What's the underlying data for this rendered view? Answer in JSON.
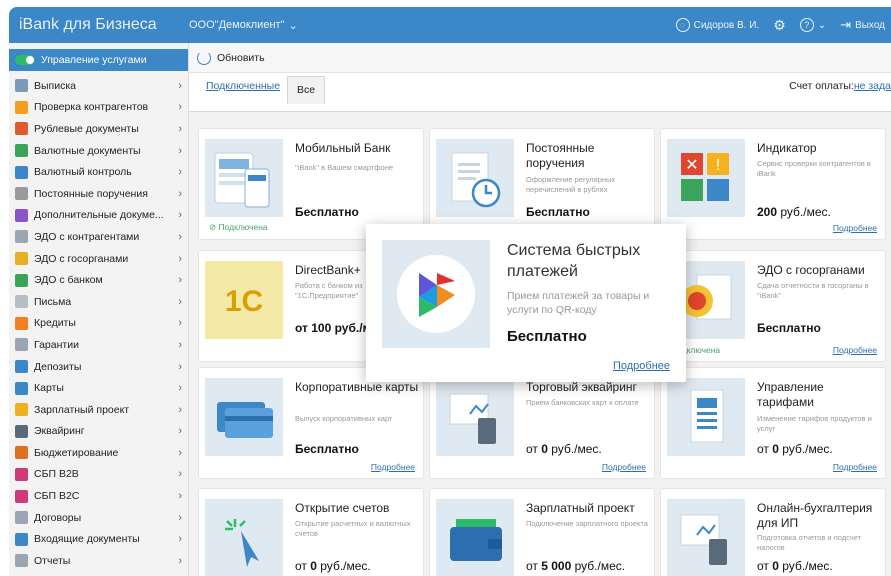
{
  "header": {
    "brand": "iBank для Бизнеса",
    "org": "ООО\"Демоклиент\"",
    "user": "Сидоров В. И.",
    "logout": "Выход"
  },
  "toolbar": {
    "refresh": "Обновить"
  },
  "sidebar": {
    "active": "Управление услугами",
    "items": [
      {
        "label": "Выписка",
        "color": "#7a9bb8"
      },
      {
        "label": "Проверка контрагентов",
        "color": "#f0a020"
      },
      {
        "label": "Рублевые документы",
        "color": "#e05a30"
      },
      {
        "label": "Валютные документы",
        "color": "#3aa55a"
      },
      {
        "label": "Валютный контроль",
        "color": "#3b87c8"
      },
      {
        "label": "Постоянные поручения",
        "color": "#9a9a9a"
      },
      {
        "label": "Дополнительные докуме...",
        "color": "#8a55c8"
      },
      {
        "label": "ЭДО с контрагентами",
        "color": "#9aa7b3"
      },
      {
        "label": "ЭДО с госорганами",
        "color": "#e8b020"
      },
      {
        "label": "ЭДО с банком",
        "color": "#3aa55a"
      },
      {
        "label": "Письма",
        "color": "#b5bec7"
      },
      {
        "label": "Кредиты",
        "color": "#f08020"
      },
      {
        "label": "Гарантии",
        "color": "#9aa7b3"
      },
      {
        "label": "Депозиты",
        "color": "#3b87c8"
      },
      {
        "label": "Карты",
        "color": "#3b87c8"
      },
      {
        "label": "Зарплатный проект",
        "color": "#f0b020"
      },
      {
        "label": "Эквайринг",
        "color": "#5a6a7a"
      },
      {
        "label": "Бюджетирование",
        "color": "#e07020"
      },
      {
        "label": "СБП B2B",
        "color": "#d03a7a"
      },
      {
        "label": "СБП B2C",
        "color": "#d03a7a"
      },
      {
        "label": "Договоры",
        "color": "#9aa7b3"
      },
      {
        "label": "Входящие документы",
        "color": "#3b87c8"
      },
      {
        "label": "Отчеты",
        "color": "#9aa7b3"
      }
    ]
  },
  "tabs": {
    "connected": "Подключенные",
    "all": "Все"
  },
  "account": {
    "label": "Счет оплаты:",
    "value": "не зада"
  },
  "popup": {
    "title": "Система быстрых платежей",
    "desc": "Прием платежей за товары и услуги по QR-коду",
    "price": "Бесплатно",
    "more": "Подробнее"
  },
  "cards": {
    "mobile": {
      "title": "Мобильный Банк",
      "desc": "\"iBank\" в Вашем смартфоне",
      "price_bold": "Бесплатно",
      "price_rest": "",
      "status": "Подключена"
    },
    "orders": {
      "title": "Постоянные поручения",
      "desc": "Оформление регулярных перечислений в рублях",
      "price_bold": "Бесплатно",
      "price_rest": ""
    },
    "indicator": {
      "title": "Индикатор",
      "desc": "Сервис проверки контрагентов в iBank",
      "price_bold": "200",
      "price_rest": " руб./мес.",
      "more": "Подробнее"
    },
    "directbank": {
      "title": "DirectBank+",
      "desc": "Работа с банком из \"1С:Предприятие\"",
      "price_bold": "",
      "price_rest": "от 100 руб./м"
    },
    "edo_gov": {
      "title": "ЭДО с госорганами",
      "desc": "Сдача отчетности в госорганы в \"iBank\"",
      "price_bold": "Бесплатно",
      "price_rest": "",
      "status": "Подключена",
      "more": "Подробнее"
    },
    "corp_cards": {
      "title": "Корпоративные карты",
      "desc": "Выпуск корпоративных карт",
      "price_bold": "Бесплатно",
      "price_rest": "",
      "more": "Подробнее"
    },
    "acquiring": {
      "title": "Торговый эквайринг",
      "desc": "Прием банковских карт к оплате",
      "price_pre": "от ",
      "price_bold": "0",
      "price_rest": " руб./мес.",
      "more": "Подробнее"
    },
    "tariffs": {
      "title": "Управление тарифами",
      "desc": "Изменение тарифов продуктов и услуг",
      "price_pre": "от ",
      "price_bold": "0",
      "price_rest": " руб./мес.",
      "more": "Подробнее"
    },
    "open_acc": {
      "title": "Открытие счетов",
      "desc": "Открытие расчетных и валютных счетов",
      "price_pre": "от ",
      "price_bold": "0",
      "price_rest": " руб./мес."
    },
    "salary": {
      "title": "Зарплатный проект",
      "desc": "Подключение зарплатного проекта",
      "price_pre": "от ",
      "price_bold": "5 000",
      "price_rest": " руб./мес."
    },
    "accounting": {
      "title": "Онлайн-бухгалтерия для ИП",
      "desc": "Подготовка отчетов и подсчет налогов",
      "price_pre": "от ",
      "price_bold": "0",
      "price_rest": " руб./мес."
    }
  }
}
